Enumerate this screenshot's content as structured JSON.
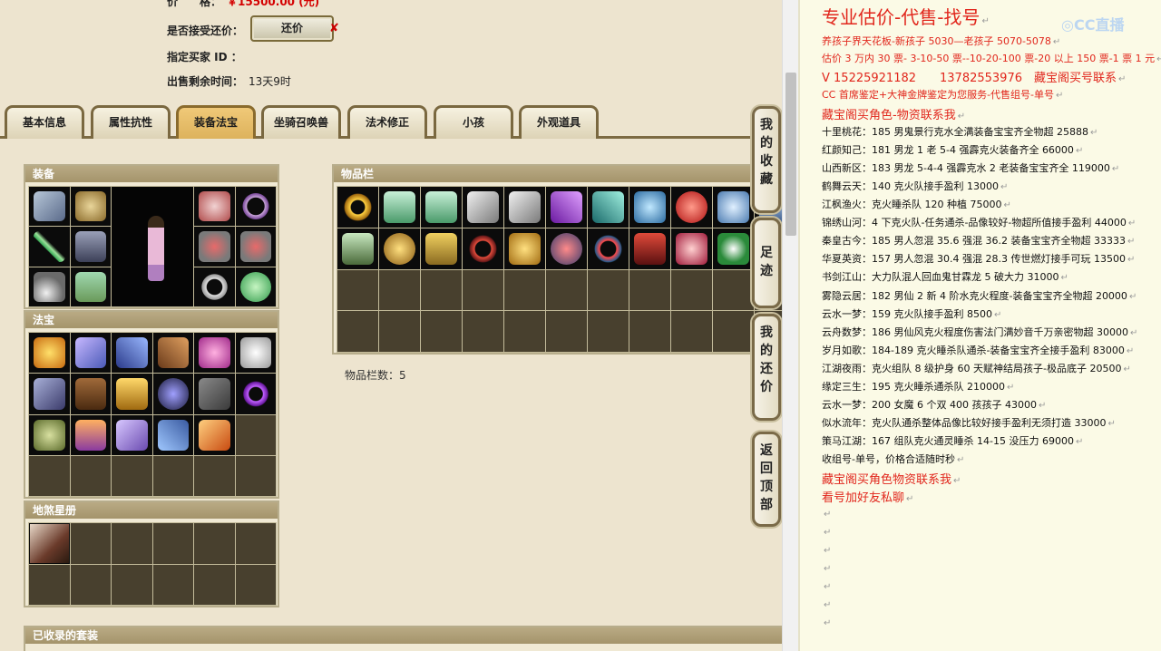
{
  "trade": {
    "price_label": "价　　格：",
    "price_value": "￥15500.00 (元)",
    "bargain_label": "是否接受还价：",
    "bargain_button": "还价",
    "buyer_label": "指定买家 ID ：",
    "remain_label": "出售剩余时间：",
    "remain_value": "13天9时"
  },
  "tabs": [
    {
      "label": "基本信息"
    },
    {
      "label": "属性抗性"
    },
    {
      "label": "装备法宝"
    },
    {
      "label": "坐骑召唤兽"
    },
    {
      "label": "法术修正"
    },
    {
      "label": "小孩"
    },
    {
      "label": "外观道具"
    }
  ],
  "active_tab": "装备法宝",
  "panels": {
    "equip_title": "装备",
    "fabao_title": "法宝",
    "star_title": "地煞星册",
    "bag_title": "物品栏",
    "bag_count": "物品栏数：5",
    "suit_title": "已收录的套装"
  },
  "side_buttons": {
    "fav": [
      "我",
      "的",
      "收",
      "藏"
    ],
    "trace": [
      "足",
      "迹"
    ],
    "bargain": [
      "我",
      "的",
      "还",
      "价"
    ],
    "top": [
      "返",
      "回",
      "顶",
      "部"
    ]
  },
  "notes": {
    "title": "专业估价-代售-找号",
    "lines": [
      {
        "text": "养孩子界天花板-新孩子 5030—老孩子 5070-5078",
        "style": "red"
      },
      {
        "text": "估价 3 万内 30 票- 3-10-50 票--10-20-100 票-20 以上 150 票-1 票 1 元",
        "style": "red"
      },
      {
        "text": "V 15225921182　　13782553976　藏宝阁买号联系",
        "style": "red med"
      },
      {
        "text": "CC 首席鉴定+大神金牌鉴定为您服务-代售组号-单号",
        "style": "red"
      },
      {
        "text": "藏宝阁买角色-物资联系我",
        "style": "red med"
      },
      {
        "text": "十里桃花：185 男鬼景行克水全满装备宝宝齐全物超 25888",
        "style": ""
      },
      {
        "text": "红颜知己：181 男龙 1 老 5-4 强霹克火装备齐全 66000",
        "style": ""
      },
      {
        "text": "山西新区：183 男龙 5-4-4 强霹克水 2 老装备宝宝齐全 119000",
        "style": ""
      },
      {
        "text": "鹤舞云天：140 克火队接手盈利 13000",
        "style": ""
      },
      {
        "text": "江枫渔火：克火睡杀队 120 种植 75000",
        "style": ""
      },
      {
        "text": "锦绣山河：4 下克火队-任务通杀-品像较好-物超所值接手盈利 44000",
        "style": ""
      },
      {
        "text": "秦皇古今：185 男人忽混 35.6 强混 36.2 装备宝宝齐全物超 33333",
        "style": ""
      },
      {
        "text": "华夏英资：157 男人忽混 30.4 强混 28.3 传世燃灯接手可玩 13500",
        "style": ""
      },
      {
        "text": "书剑江山：大力队混人回血鬼甘霖龙 5 破大力 31000",
        "style": ""
      },
      {
        "text": "雾隐云居：182 男仙 2 新 4 阶水克火程度-装备宝宝齐全物超 20000",
        "style": ""
      },
      {
        "text": "云水一梦：159 克火队接手盈利 8500",
        "style": ""
      },
      {
        "text": "云舟数梦：186 男仙风克火程度伤害法门满妙音千万亲密物超 30000",
        "style": ""
      },
      {
        "text": "岁月如歌：184-189 克火睡杀队通杀-装备宝宝齐全接手盈利 83000",
        "style": ""
      },
      {
        "text": "江湖夜雨：克火组队 8 级护身 60 天赋神结局孩子-极品底子 20500",
        "style": ""
      },
      {
        "text": "缘定三生：195 克火睡杀通杀队 210000",
        "style": ""
      },
      {
        "text": "云水一梦：200 女魔 6 个双 400 孩孩子 43000",
        "style": ""
      },
      {
        "text": "似水流年：克火队通杀整体品像比较好接手盈利无须打造 33000",
        "style": ""
      },
      {
        "text": "策马江湖：167 组队克火通灵睡杀 14-15 没压力 69000",
        "style": ""
      },
      {
        "text": "收组号-单号，价格合适随时秒",
        "style": ""
      },
      {
        "text": "藏宝阁买角色物资联系我",
        "style": "red med"
      },
      {
        "text": "看号加好友私聊",
        "style": "red med"
      }
    ],
    "return_mark": "↵"
  },
  "colors": {
    "accent_red": "#e1261c",
    "tab_active": "#e2b863",
    "panel_head": "#ad9d73"
  },
  "icons": {
    "equip": [
      "robe-icon",
      "skull-helmet-icon",
      "mask-icon",
      "necklace-icon",
      "sword-icon",
      "armor-icon",
      "ruby-belt-icon",
      "ruby-belt-icon-2",
      "pendant-icon",
      "boots-icon",
      "ring-icon",
      "jade-orb-icon"
    ],
    "fabao": [
      "golden-crown-icon",
      "scroll-icon",
      "claw-icon",
      "lute-icon",
      "lantern-icon",
      "cloud-icon",
      "blade-icon",
      "shield-icon",
      "pagoda-icon",
      "vortex-icon",
      "book-icon",
      "whip-icon",
      "cube-icon",
      "glove-icon",
      "fan-icon",
      "wrist-icon",
      "bell-icon"
    ],
    "star": [
      "warrior-portrait-icon"
    ],
    "bag": [
      "gold-ring-icon",
      "jade-robe-icon",
      "jade-robe-icon-2",
      "axe-icon",
      "axe-icon-2",
      "purple-gem-icon",
      "green-box-icon",
      "blue-orb-icon",
      "red-jewel-icon",
      "sapphire-icon",
      "rune-icon",
      "jade-belt-icon",
      "ring-gold-icon",
      "cape-icon",
      "red-ribbon-icon",
      "gold-mask-icon",
      "red-orb-icon",
      "necklace-red-icon",
      "red-armor-icon",
      "crimson-crown-icon",
      "leaf-talisman-icon"
    ]
  }
}
